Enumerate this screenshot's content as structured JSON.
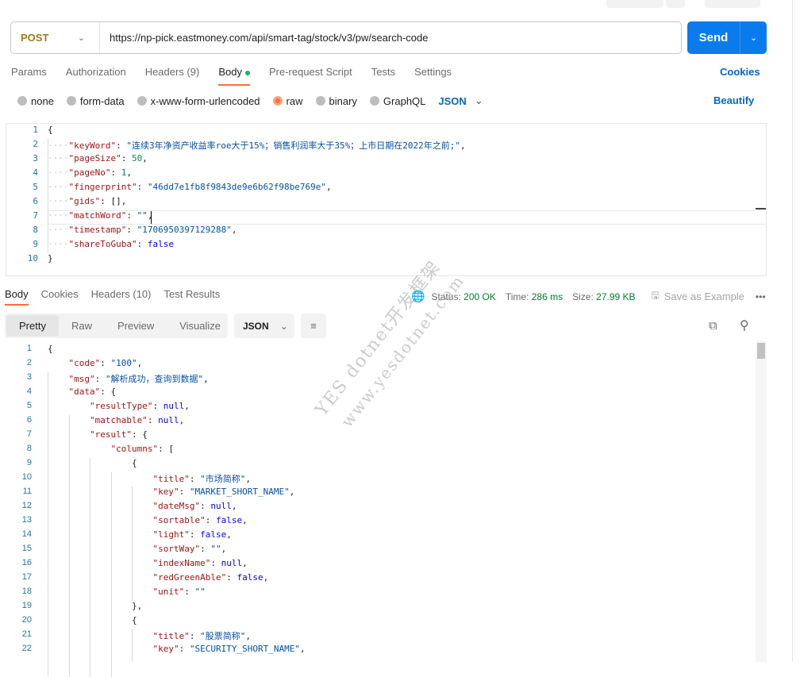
{
  "request": {
    "method": "POST",
    "url": "https://np-pick.eastmoney.com/api/smart-tag/stock/v3/pw/search-code",
    "send_label": "Send"
  },
  "req_tabs": [
    {
      "label": "Params"
    },
    {
      "label": "Authorization"
    },
    {
      "label": "Headers (9)"
    },
    {
      "label": "Body",
      "active": true
    },
    {
      "label": "Pre-request Script"
    },
    {
      "label": "Tests"
    },
    {
      "label": "Settings"
    }
  ],
  "cookies_label": "Cookies",
  "body_types": [
    {
      "label": "none"
    },
    {
      "label": "form-data"
    },
    {
      "label": "x-www-form-urlencoded"
    },
    {
      "label": "raw",
      "selected": true
    },
    {
      "label": "binary"
    },
    {
      "label": "GraphQL"
    }
  ],
  "body_format": "JSON",
  "beautify_label": "Beautify",
  "request_body": [
    [
      0,
      [
        [
          "p",
          "{"
        ]
      ]
    ],
    [
      1,
      [
        [
          "k",
          "\"keyWord\""
        ],
        [
          "p",
          ": "
        ],
        [
          "s",
          "\"连续3年净资产收益率roe大于15%；销售利润率大于35%；上市日期在2022年之前;\""
        ],
        [
          "p",
          ","
        ]
      ]
    ],
    [
      1,
      [
        [
          "k",
          "\"pageSize\""
        ],
        [
          "p",
          ": "
        ],
        [
          "n",
          "50"
        ],
        [
          "p",
          ","
        ]
      ]
    ],
    [
      1,
      [
        [
          "k",
          "\"pageNo\""
        ],
        [
          "p",
          ": "
        ],
        [
          "n",
          "1"
        ],
        [
          "p",
          ","
        ]
      ]
    ],
    [
      1,
      [
        [
          "k",
          "\"fingerprint\""
        ],
        [
          "p",
          ": "
        ],
        [
          "s",
          "\"46dd7e1fb8f9843de9e6b62f98be769e\""
        ],
        [
          "p",
          ","
        ]
      ]
    ],
    [
      1,
      [
        [
          "k",
          "\"gids\""
        ],
        [
          "p",
          ": "
        ],
        [
          "p",
          "[]"
        ],
        [
          "p",
          ","
        ]
      ]
    ],
    [
      1,
      [
        [
          "k",
          "\"matchWord\""
        ],
        [
          "p",
          ": "
        ],
        [
          "s",
          "\"\""
        ],
        [
          "p",
          ","
        ]
      ]
    ],
    [
      1,
      [
        [
          "k",
          "\"timestamp\""
        ],
        [
          "p",
          ": "
        ],
        [
          "s",
          "\"1706950397129288\""
        ],
        [
          "p",
          ","
        ]
      ]
    ],
    [
      1,
      [
        [
          "k",
          "\"shareToGuba\""
        ],
        [
          "p",
          ": "
        ],
        [
          "b",
          "false"
        ]
      ]
    ],
    [
      0,
      [
        [
          "p",
          "}"
        ]
      ]
    ]
  ],
  "resp_tabs": [
    {
      "label": "Body",
      "active": true
    },
    {
      "label": "Cookies"
    },
    {
      "label": "Headers (10)"
    },
    {
      "label": "Test Results"
    }
  ],
  "meta": {
    "status_label": "Status:",
    "status": "200 OK",
    "time_label": "Time:",
    "time": "286 ms",
    "size_label": "Size:",
    "size": "27.99 KB",
    "save_label": "Save as Example"
  },
  "view_modes": [
    {
      "label": "Pretty",
      "active": true
    },
    {
      "label": "Raw"
    },
    {
      "label": "Preview"
    },
    {
      "label": "Visualize"
    }
  ],
  "resp_format": "JSON",
  "response_body": [
    [
      0,
      [
        [
          "p",
          "{"
        ]
      ]
    ],
    [
      1,
      [
        [
          "k",
          "\"code\""
        ],
        [
          "p",
          ": "
        ],
        [
          "s",
          "\"100\""
        ],
        [
          "p",
          ","
        ]
      ]
    ],
    [
      1,
      [
        [
          "k",
          "\"msg\""
        ],
        [
          "p",
          ": "
        ],
        [
          "s",
          "\"解析成功，查询到数据\""
        ],
        [
          "p",
          ","
        ]
      ]
    ],
    [
      1,
      [
        [
          "k",
          "\"data\""
        ],
        [
          "p",
          ": {"
        ]
      ]
    ],
    [
      2,
      [
        [
          "k",
          "\"resultType\""
        ],
        [
          "p",
          ": "
        ],
        [
          "b",
          "null"
        ],
        [
          "p",
          ","
        ]
      ]
    ],
    [
      2,
      [
        [
          "k",
          "\"matchable\""
        ],
        [
          "p",
          ": "
        ],
        [
          "b",
          "null"
        ],
        [
          "p",
          ","
        ]
      ]
    ],
    [
      2,
      [
        [
          "k",
          "\"result\""
        ],
        [
          "p",
          ": {"
        ]
      ]
    ],
    [
      3,
      [
        [
          "k",
          "\"columns\""
        ],
        [
          "p",
          ": ["
        ]
      ]
    ],
    [
      4,
      [
        [
          "p",
          "{"
        ]
      ]
    ],
    [
      5,
      [
        [
          "k",
          "\"title\""
        ],
        [
          "p",
          ": "
        ],
        [
          "s",
          "\"市场简称\""
        ],
        [
          "p",
          ","
        ]
      ]
    ],
    [
      5,
      [
        [
          "k",
          "\"key\""
        ],
        [
          "p",
          ": "
        ],
        [
          "s",
          "\"MARKET_SHORT_NAME\""
        ],
        [
          "p",
          ","
        ]
      ]
    ],
    [
      5,
      [
        [
          "k",
          "\"dateMsg\""
        ],
        [
          "p",
          ": "
        ],
        [
          "b",
          "null"
        ],
        [
          "p",
          ","
        ]
      ]
    ],
    [
      5,
      [
        [
          "k",
          "\"sortable\""
        ],
        [
          "p",
          ": "
        ],
        [
          "b",
          "false"
        ],
        [
          "p",
          ","
        ]
      ]
    ],
    [
      5,
      [
        [
          "k",
          "\"light\""
        ],
        [
          "p",
          ": "
        ],
        [
          "b",
          "false"
        ],
        [
          "p",
          ","
        ]
      ]
    ],
    [
      5,
      [
        [
          "k",
          "\"sortWay\""
        ],
        [
          "p",
          ": "
        ],
        [
          "s",
          "\"\""
        ],
        [
          "p",
          ","
        ]
      ]
    ],
    [
      5,
      [
        [
          "k",
          "\"indexName\""
        ],
        [
          "p",
          ": "
        ],
        [
          "b",
          "null"
        ],
        [
          "p",
          ","
        ]
      ]
    ],
    [
      5,
      [
        [
          "k",
          "\"redGreenAble\""
        ],
        [
          "p",
          ": "
        ],
        [
          "b",
          "false"
        ],
        [
          "p",
          ","
        ]
      ]
    ],
    [
      5,
      [
        [
          "k",
          "\"unit\""
        ],
        [
          "p",
          ": "
        ],
        [
          "s",
          "\"\""
        ]
      ]
    ],
    [
      4,
      [
        [
          "p",
          "},"
        ]
      ]
    ],
    [
      4,
      [
        [
          "p",
          "{"
        ]
      ]
    ],
    [
      5,
      [
        [
          "k",
          "\"title\""
        ],
        [
          "p",
          ": "
        ],
        [
          "s",
          "\"股票简称\""
        ],
        [
          "p",
          ","
        ]
      ]
    ],
    [
      5,
      [
        [
          "k",
          "\"key\""
        ],
        [
          "p",
          ": "
        ],
        [
          "s",
          "\"SECURITY_SHORT_NAME\""
        ],
        [
          "p",
          ","
        ]
      ]
    ]
  ],
  "watermark": {
    "line1": "YES dotnet开发框架",
    "line2": "www.yesdotnet.com"
  },
  "colors": {
    "accent": "#ff6c37",
    "primary": "#097bed",
    "status_ok": "#007f31"
  }
}
